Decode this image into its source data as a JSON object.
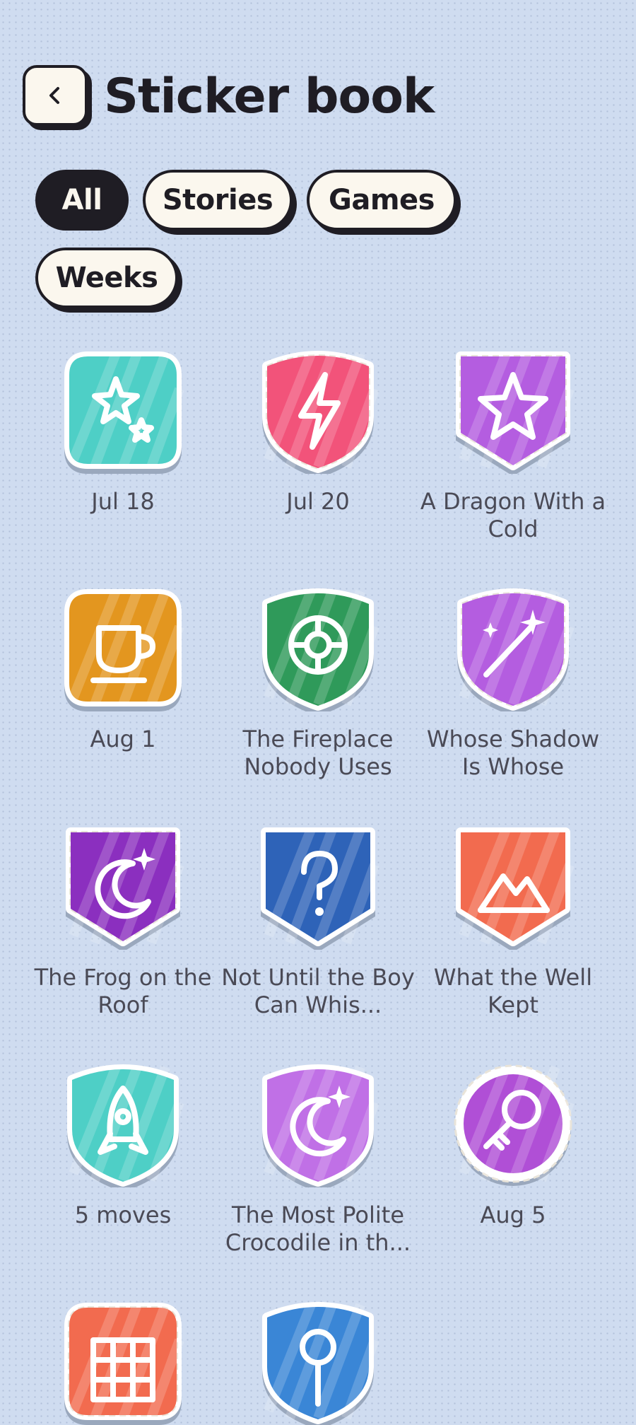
{
  "header": {
    "title": "Sticker book",
    "back_icon": "chevron-left-icon"
  },
  "filters": [
    {
      "label": "All",
      "active": true
    },
    {
      "label": "Stories",
      "active": false
    },
    {
      "label": "Games",
      "active": false
    },
    {
      "label": "Weeks",
      "active": false
    }
  ],
  "stickers": [
    {
      "label": "Jul 18",
      "icon": "stars-icon",
      "shape": "rounded-square",
      "color": "#4ecfc6"
    },
    {
      "label": "Jul 20",
      "icon": "lightning-icon",
      "shape": "shield-dashed",
      "color": "#f2537a"
    },
    {
      "label": "A Dragon With a Cold",
      "icon": "star-icon",
      "shape": "pennant-dashed",
      "color": "#b45de0"
    },
    {
      "label": "Aug 1",
      "icon": "cup-icon",
      "shape": "rounded-square",
      "color": "#e3961f"
    },
    {
      "label": "The Fireplace Nobody Uses",
      "icon": "life-ring-icon",
      "shape": "shield",
      "color": "#2f9a5a"
    },
    {
      "label": "Whose Shadow Is Whose",
      "icon": "magic-wand-icon",
      "shape": "shield-dashed",
      "color": "#b45de0"
    },
    {
      "label": "The Frog on the Roof",
      "icon": "moon-icon",
      "shape": "pennant-dashed",
      "color": "#8b2fbf"
    },
    {
      "label": "Not Until the Boy Can Whis...",
      "icon": "question-icon",
      "shape": "pennant",
      "color": "#2e63b8"
    },
    {
      "label": "What the Well Kept",
      "icon": "mountain-icon",
      "shape": "pennant",
      "color": "#f26b4f"
    },
    {
      "label": "5 moves",
      "icon": "rocket-icon",
      "shape": "shield",
      "color": "#4ecfc6"
    },
    {
      "label": "The Most Polite Crocodile in th...",
      "icon": "moon-icon",
      "shape": "shield",
      "color": "#c070e6"
    },
    {
      "label": "Aug 5",
      "icon": "key-icon",
      "shape": "circle-dashed",
      "color": "#b04fd6"
    },
    {
      "label": "",
      "icon": "grid-icon",
      "shape": "rounded-square-dashed",
      "color": "#f26b4f"
    },
    {
      "label": "",
      "icon": "keyhole-icon",
      "shape": "shield",
      "color": "#3a86d6"
    }
  ]
}
